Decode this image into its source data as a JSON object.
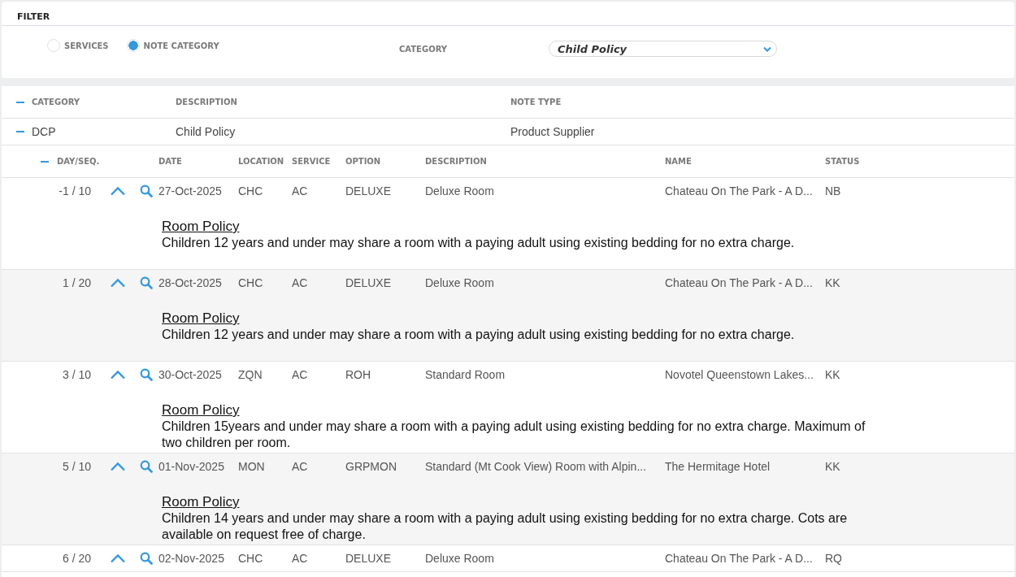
{
  "filter": {
    "title": "FILTER",
    "radios": [
      {
        "label": "SERVICES",
        "selected": false
      },
      {
        "label": "NOTE CATEGORY",
        "selected": true
      }
    ],
    "category_label": "CATEGORY",
    "category_value": "Child Policy"
  },
  "category_table": {
    "expanded": true,
    "columns": [
      "CATEGORY",
      "DESCRIPTION",
      "NOTE TYPE"
    ],
    "rows": [
      {
        "expanded": true,
        "cells": [
          "DCP",
          "Child Policy",
          "Product Supplier"
        ]
      }
    ]
  },
  "service_table": {
    "expanded": true,
    "columns": [
      "DAY/SEQ.",
      "DATE",
      "LOCATION",
      "SERVICE",
      "OPTION",
      "DESCRIPTION",
      "NAME",
      "STATUS"
    ],
    "rows": [
      {
        "day_seq": "-1 / 10",
        "date": "27-Oct-2025",
        "location": "CHC",
        "service": "AC",
        "option": "DELUXE",
        "description": "Deluxe Room",
        "name": "Chateau On The Park - A D...",
        "status": "NB",
        "note_title": "Room Policy",
        "note_text": "Children 12 years and under may share a room with a paying adult using existing bedding for no extra charge."
      },
      {
        "day_seq": "1 / 20",
        "date": "28-Oct-2025",
        "location": "CHC",
        "service": "AC",
        "option": "DELUXE",
        "description": "Deluxe Room",
        "name": "Chateau On The Park - A D...",
        "status": "KK",
        "note_title": "Room Policy",
        "note_text": "Children 12 years and under may share a room with a paying adult using existing bedding for no extra charge."
      },
      {
        "day_seq": "3 / 10",
        "date": "30-Oct-2025",
        "location": "ZQN",
        "service": "AC",
        "option": "ROH",
        "description": "Standard Room",
        "name": "Novotel Queenstown Lakes...",
        "status": "KK",
        "note_title": "Room Policy",
        "note_text": "Children 15years and under may share a room with a paying adult using existing bedding for no extra charge. Maximum of two children per room."
      },
      {
        "day_seq": "5 / 10",
        "date": "01-Nov-2025",
        "location": "MON",
        "service": "AC",
        "option": "GRPMON",
        "description": "Standard (Mt Cook View) Room with Alpin...",
        "name": "The Hermitage Hotel",
        "status": "KK",
        "note_title": "Room Policy",
        "note_text": "Children 14 years and under may share a room with a paying adult using existing bedding for no extra charge. Cots are available on request free of charge."
      },
      {
        "day_seq": "6 / 20",
        "date": "02-Nov-2025",
        "location": "CHC",
        "service": "AC",
        "option": "DELUXE",
        "description": "Deluxe Room",
        "name": "Chateau On The Park - A D...",
        "status": "RQ"
      }
    ]
  }
}
